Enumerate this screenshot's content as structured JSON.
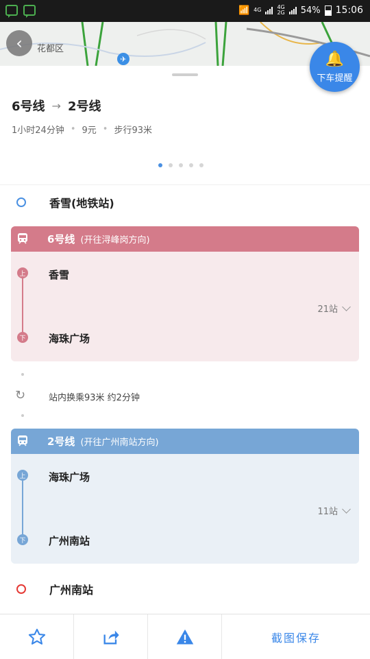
{
  "status_bar": {
    "network_1": "4G",
    "network_2a": "4G",
    "network_2b": "2G",
    "battery": "54%",
    "time": "15:06"
  },
  "map": {
    "district_label": "花都区",
    "alight_reminder_label": "下车提醒"
  },
  "summary": {
    "from_line": "6号线",
    "to_line": "2号线",
    "duration": "1小时24分钟",
    "fare": "9元",
    "walk": "步行93米",
    "page_count": 5,
    "active_page": 1
  },
  "origin": {
    "name": "香雪(地铁站)"
  },
  "legs": [
    {
      "line": "6号线",
      "direction": "(开往浔峰岗方向)",
      "board_badge": "上",
      "alight_badge": "下",
      "board_stop": "香雪",
      "alight_stop": "海珠广场",
      "stops": "21站",
      "color": "#d47b8a",
      "bg": "#f7eaec"
    },
    {
      "line": "2号线",
      "direction": "(开往广州南站方向)",
      "board_badge": "上",
      "alight_badge": "下",
      "board_stop": "海珠广场",
      "alight_stop": "广州南站",
      "stops": "11站",
      "color": "#77a6d6",
      "bg": "#eaf0f6"
    }
  ],
  "transfer": {
    "text": "站内换乘93米  约2分钟"
  },
  "destination": {
    "name": "广州南站"
  },
  "bottom_bar": {
    "save_label": "截图保存"
  },
  "colors": {
    "accent_blue": "#3a87e8",
    "origin_ring": "#4a90e2",
    "destination_ring": "#e53935"
  }
}
